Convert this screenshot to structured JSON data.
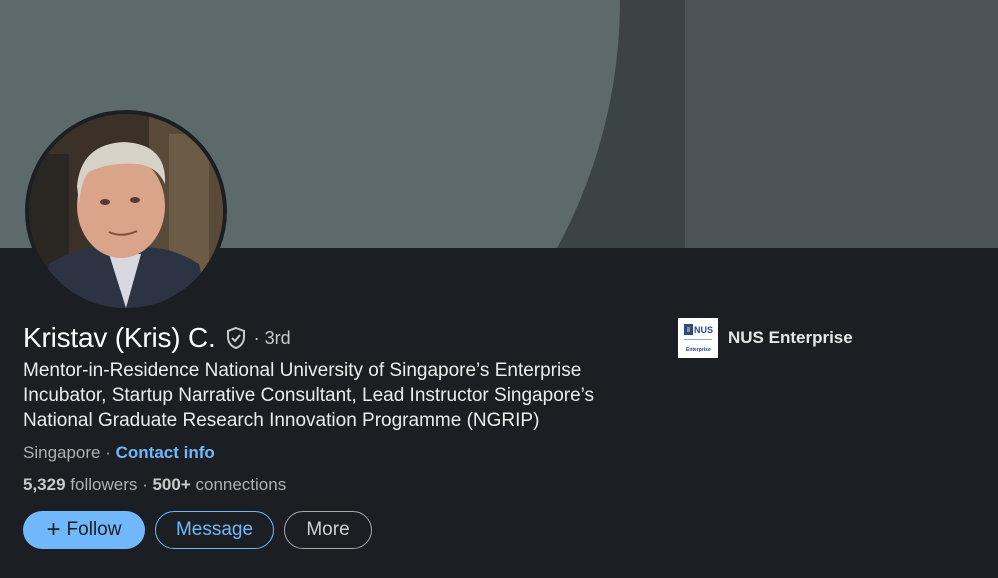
{
  "profile": {
    "name": "Kristav (Kris) C.",
    "degree": "· 3rd",
    "headline": "Mentor-in-Residence National University of Singapore’s Enterprise Incubator, Startup Narrative Consultant, Lead Instructor Singapore’s National Graduate Research Innovation Programme (NGRIP)",
    "location": "Singapore",
    "location_separator": " · ",
    "contact_info": "Contact info",
    "followers": "5,329",
    "followers_label": " followers",
    "connections_prefix": " · ",
    "connections": "500+",
    "connections_label": " connections"
  },
  "company": {
    "name": "NUS Enterprise",
    "logo_text_top": "NUS",
    "logo_text_bottom": "Enterprise"
  },
  "actions": {
    "follow_label": "Follow",
    "message_label": "Message",
    "more_label": "More"
  },
  "colors": {
    "background": "#1b1f23",
    "accent": "#71b7fb",
    "banner_light": "#5c6a6b",
    "banner_dark": "#3c4345"
  },
  "icons": [
    "verified-shield-icon",
    "plus-icon",
    "company-logo"
  ]
}
